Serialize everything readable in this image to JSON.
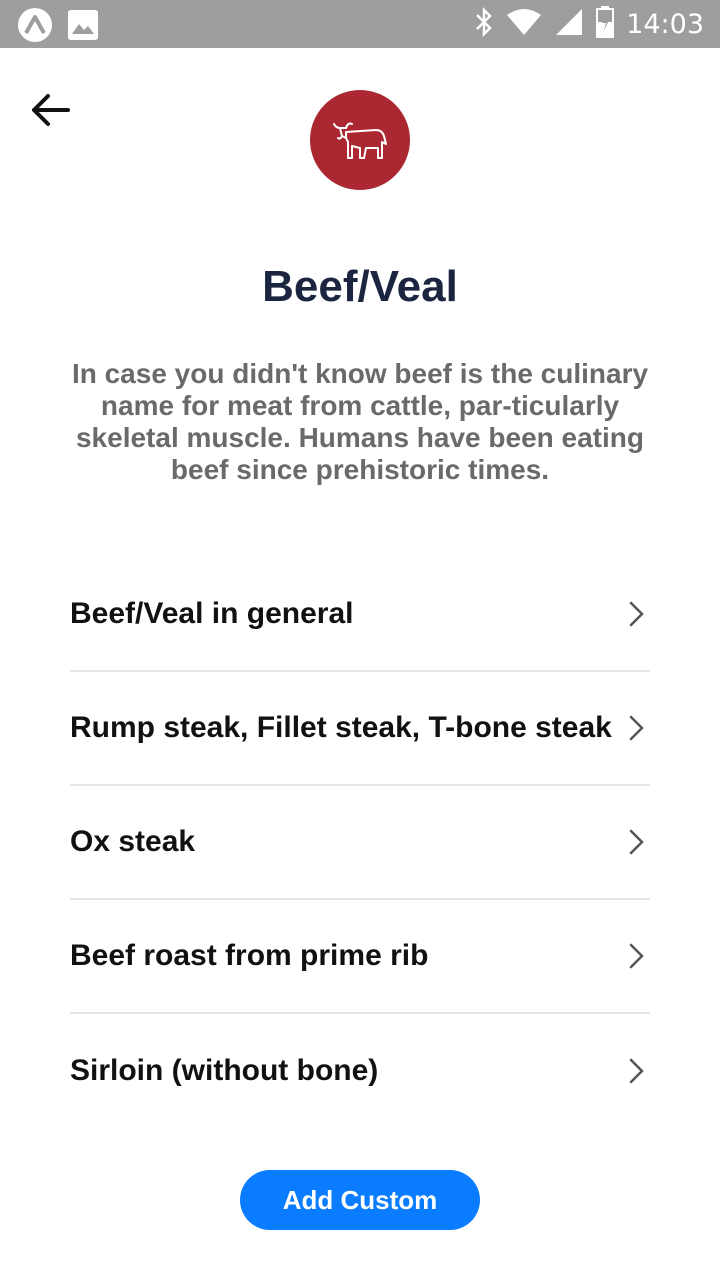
{
  "status_bar": {
    "time": "14:03",
    "icons": [
      "app-a-icon",
      "image-icon",
      "bluetooth-icon",
      "wifi-icon",
      "signal-icon",
      "battery-icon"
    ]
  },
  "header": {
    "back_icon": "back-arrow-icon",
    "logo_icon": "cow-icon",
    "logo_color": "#ab2832"
  },
  "title": "Beef/Veal",
  "description": "In case you didn't know beef is the culinary name for meat from cattle, par-ticularly skeletal muscle. Humans have been eating beef since prehistoric times.",
  "items": [
    {
      "label": "Beef/Veal in general"
    },
    {
      "label": "Rump steak, Fillet steak, T-bone steak"
    },
    {
      "label": "Ox steak"
    },
    {
      "label": "Beef roast from prime rib"
    },
    {
      "label": "Sirloin (without bone)"
    }
  ],
  "add_button": {
    "label": "Add Custom",
    "color": "#0a7cff"
  }
}
